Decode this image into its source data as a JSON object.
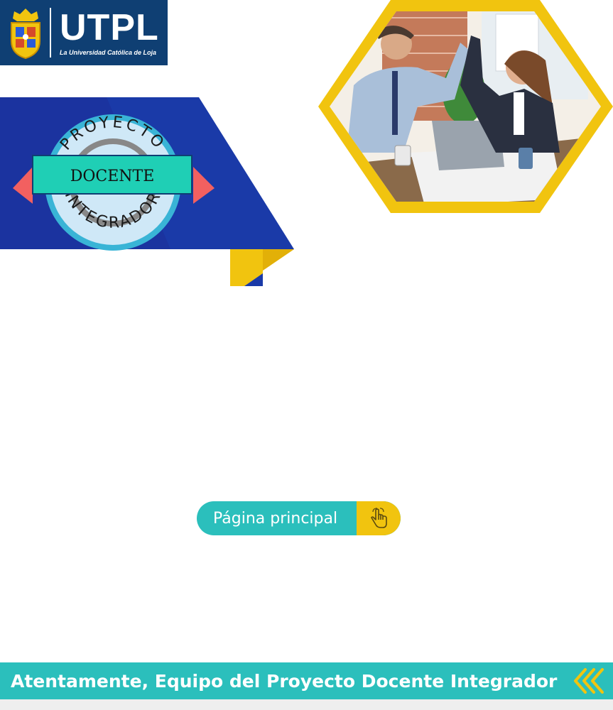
{
  "logo": {
    "name": "UTPL",
    "tagline": "La Universidad Católica de Loja"
  },
  "badge": {
    "arc_top": "PROYECTO",
    "center": "DOCENTE",
    "arc_bottom": "INTEGRADOR"
  },
  "main_button": {
    "label": "Página principal"
  },
  "footer": {
    "message": "Atentamente, Equipo del Proyecto Docente Integrador"
  },
  "colors": {
    "navy": "#0f3f73",
    "banner_blue": "#1a3aa8",
    "teal": "#2bbfbc",
    "yellow": "#f1c40f",
    "coral": "#f26060",
    "mint": "#1fcfb5"
  },
  "icons": {
    "crest": "university-crest-icon",
    "hand": "pointing-hand-icon",
    "chevrons": "double-chevron-left-icon"
  }
}
